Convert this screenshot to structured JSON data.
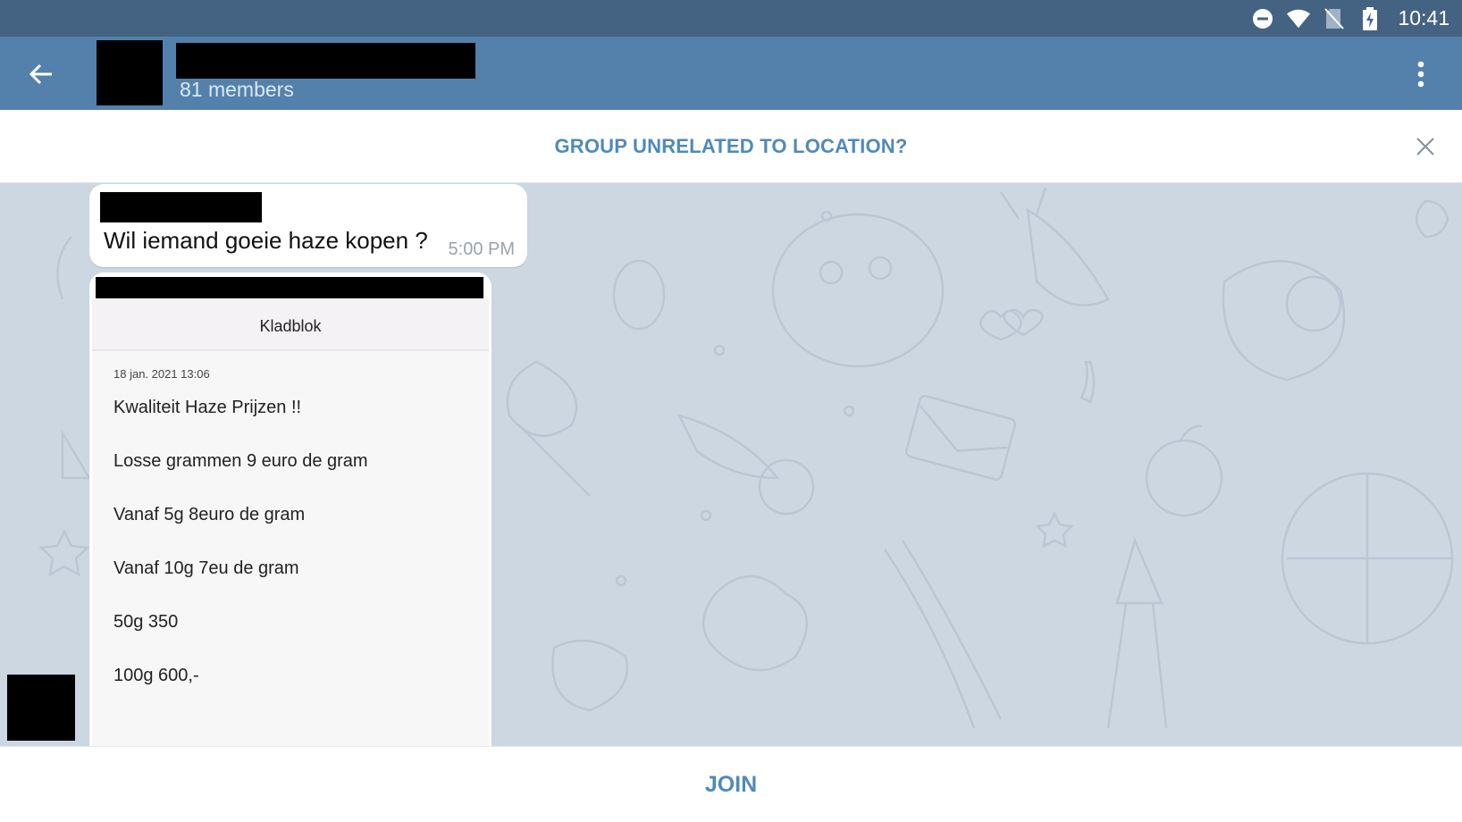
{
  "status_bar": {
    "time": "10:41",
    "icons": [
      "do-not-disturb-icon",
      "wifi-icon",
      "no-sim-icon",
      "battery-charging-icon"
    ]
  },
  "header": {
    "back_icon": "arrow-left-icon",
    "members": "81 members",
    "menu_icon": "more-vertical-icon"
  },
  "banner": {
    "text": "GROUP UNRELATED TO LOCATION?",
    "close_icon": "close-icon"
  },
  "messages": [
    {
      "text": "Wil iemand goeie haze kopen ?",
      "time": "5:00 PM"
    },
    {
      "note": {
        "title": "Kladblok",
        "date": "18 jan. 2021 13:06",
        "lines": [
          "Kwaliteit Haze Prijzen !!",
          "Losse grammen 9 euro de gram",
          "Vanaf 5g 8euro de gram",
          "Vanaf 10g 7eu de gram",
          "50g 350",
          "100g 600,-"
        ]
      }
    }
  ],
  "bottom": {
    "join_label": "JOIN"
  },
  "colors": {
    "status_bar": "#446383",
    "header": "#5381ab",
    "accent": "#4f8ab9",
    "chat_bg": "#cdd7e2"
  }
}
